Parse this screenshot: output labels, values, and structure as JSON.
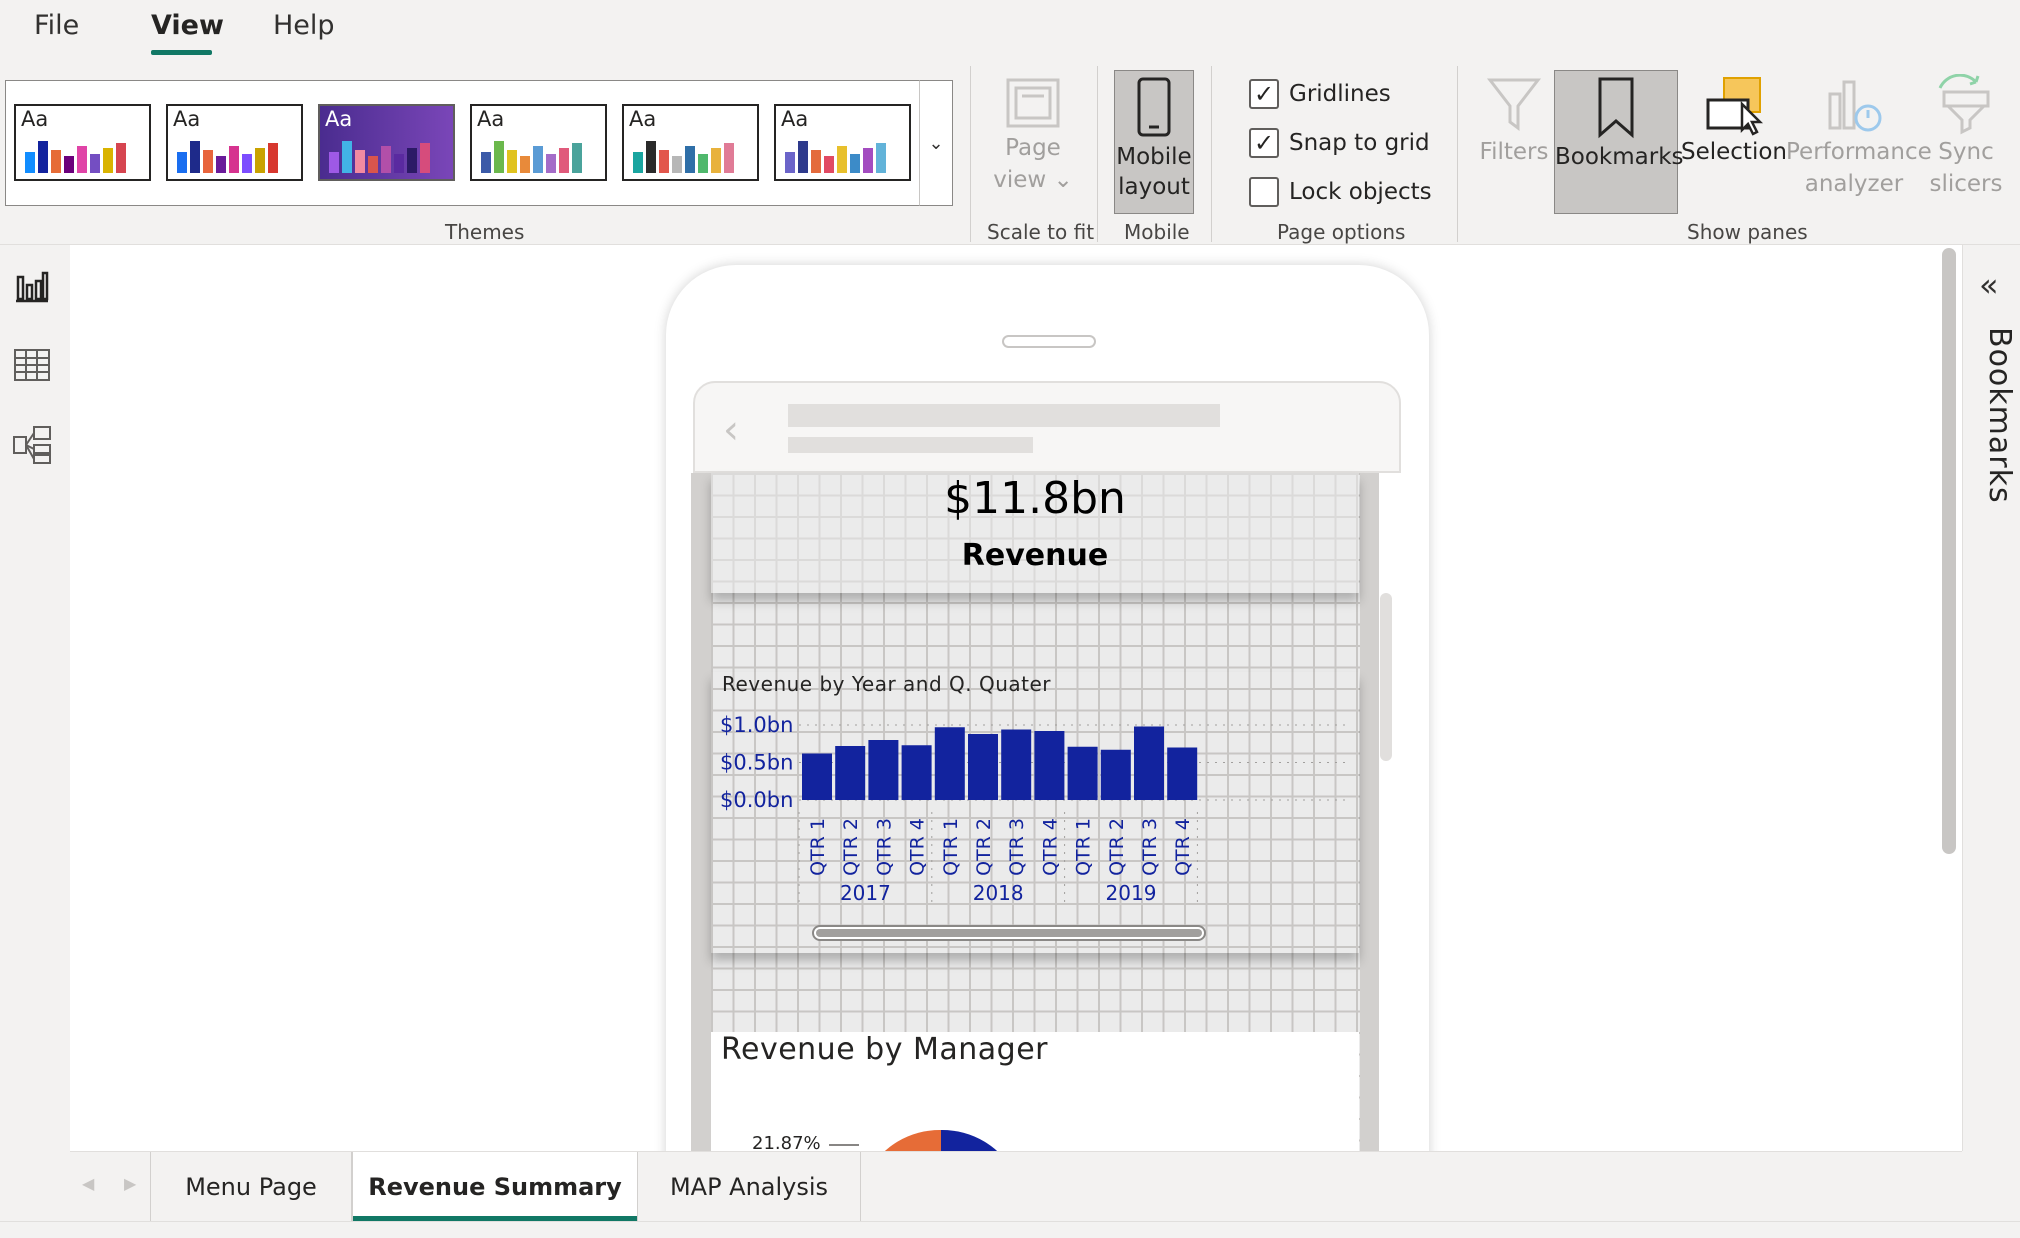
{
  "menu": {
    "items": [
      "File",
      "View",
      "Help"
    ],
    "active": "View"
  },
  "ribbon": {
    "groups": {
      "themes": "Themes",
      "scale_to_fit": "Scale to fit",
      "mobile": "Mobile",
      "page_options": "Page options",
      "show_panes": "Show panes"
    },
    "theme_swatches": [
      {
        "aa": "Aa",
        "style": "light",
        "bars": [
          "#118dff",
          "#12239e",
          "#e66c37",
          "#6b007b",
          "#e044a7",
          "#744ec2",
          "#d9b300",
          "#d64550"
        ]
      },
      {
        "aa": "Aa",
        "style": "light",
        "bars": [
          "#1a6ef0",
          "#1e2a8a",
          "#e8643c",
          "#6a1b9a",
          "#d6338f",
          "#7c4dff",
          "#c9a200",
          "#d7372e"
        ]
      },
      {
        "aa": "Aa",
        "style": "dark",
        "bars": [
          "#9e59e6",
          "#42b3e6",
          "#f28aa1",
          "#d9554c",
          "#b24fa9",
          "#5a2aa0",
          "#2c1a66",
          "#d64c7c"
        ]
      },
      {
        "aa": "Aa",
        "style": "light",
        "bars": [
          "#3b5aa8",
          "#6bb84c",
          "#e0c31f",
          "#e88a3a",
          "#5a9bd5",
          "#a46cc8",
          "#e05a7b",
          "#4aa39b"
        ]
      },
      {
        "aa": "Aa",
        "style": "light",
        "bars": [
          "#1aa5a0",
          "#2b2b2b",
          "#e2574c",
          "#b7b7b7",
          "#2f6fa8",
          "#4fb86c",
          "#e8b23c",
          "#e07b96"
        ]
      },
      {
        "aa": "Aa",
        "style": "light",
        "bars": [
          "#6b64c9",
          "#2e3a8c",
          "#e46b3c",
          "#e14a63",
          "#e8c02c",
          "#3c8bc8",
          "#a34cc0",
          "#62b3d9"
        ]
      }
    ],
    "page_view": {
      "line1": "Page",
      "line2": "view",
      "chevron": "⌄"
    },
    "mobile_layout": {
      "line1": "Mobile",
      "line2": "layout"
    },
    "checkboxes": [
      {
        "label": "Gridlines",
        "checked": true,
        "mark": "✓"
      },
      {
        "label": "Snap to grid",
        "checked": true,
        "mark": "✓"
      },
      {
        "label": "Lock objects",
        "checked": false,
        "mark": ""
      }
    ],
    "panes": {
      "filters": "Filters",
      "bookmarks": "Bookmarks",
      "selection": "Selection",
      "performance_line1": "Performance",
      "performance_line2": "analyzer",
      "sync_line1": "Sync",
      "sync_line2": "slicers"
    }
  },
  "left_rail": {
    "icons": [
      "report-view-icon",
      "data-view-icon",
      "model-view-icon"
    ]
  },
  "mobile_canvas": {
    "kpi": {
      "value": "$11.8bn",
      "label": "Revenue"
    },
    "pie": {
      "title": "Revenue by Manager",
      "label": "21.87%"
    }
  },
  "chart_data": {
    "type": "bar",
    "title": "Revenue by Year and Q. Quater",
    "y_ticks": [
      "$1.0bn",
      "$0.5bn",
      "$0.0bn"
    ],
    "ylim": [
      0,
      1.0
    ],
    "categories": [
      "QTR 1",
      "QTR 2",
      "QTR 3",
      "QTR 4",
      "QTR 1",
      "QTR 2",
      "QTR 3",
      "QTR 4",
      "QTR 1",
      "QTR 2",
      "QTR 3",
      "QTR 4"
    ],
    "groups": [
      {
        "label": "2017",
        "count": 4
      },
      {
        "label": "2018",
        "count": 4
      },
      {
        "label": "2019",
        "count": 4
      }
    ],
    "values": [
      0.62,
      0.72,
      0.8,
      0.73,
      0.97,
      0.88,
      0.94,
      0.92,
      0.71,
      0.67,
      0.98,
      0.7
    ],
    "bar_color": "#12239e",
    "gridlines": true
  },
  "right_panel": {
    "title": "Bookmarks",
    "collapse_glyph": "«"
  },
  "page_tabs": {
    "tabs": [
      "Menu Page",
      "Revenue Summary",
      "MAP Analysis"
    ],
    "active": "Revenue Summary",
    "prev_glyph": "◀",
    "next_glyph": "▶"
  },
  "colors": {
    "accent": "#117865",
    "bar": "#12239e",
    "pie_orange": "#e66c37",
    "pie_blue": "#12239e"
  }
}
